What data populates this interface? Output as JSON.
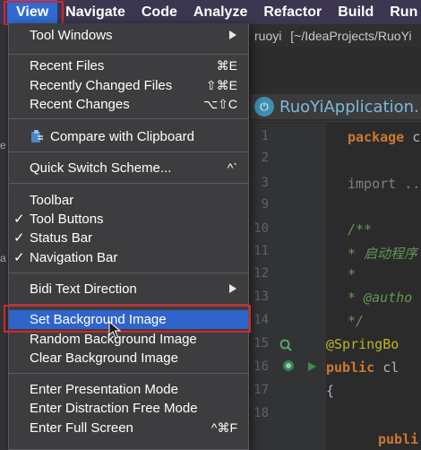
{
  "menubar": {
    "items": [
      "View",
      "Navigate",
      "Code",
      "Analyze",
      "Refactor",
      "Build",
      "Run"
    ],
    "active": "View"
  },
  "project": {
    "name": "ruoyi",
    "path": "[~/IdeaProjects/RuoYi"
  },
  "left_fragments": [
    "e",
    "a"
  ],
  "editor": {
    "tab_label": "RuoYiApplication.",
    "line_numbers": [
      "1",
      "2",
      "3",
      "9",
      "10",
      "11",
      "12",
      "13",
      "14",
      "15",
      "16",
      "17",
      "18"
    ],
    "code_lines": [
      {
        "kw": "package",
        "pl": " c"
      },
      {
        "dim": "import ..."
      },
      {
        "cm": "/**"
      },
      {
        "cm": " * 启动程序"
      },
      {
        "cm": " *"
      },
      {
        "cm": " * @autho"
      },
      {
        "cm": " */"
      },
      {
        "an": "@SpringBo"
      },
      {
        "kw": "public",
        "pl": " cl"
      },
      {
        "pl": "{"
      },
      {
        "kw": "publi"
      }
    ]
  },
  "view_menu": {
    "tool_windows": "Tool Windows",
    "recent_files": "Recent Files",
    "recent_files_sc": "⌘E",
    "recently_changed": "Recently Changed Files",
    "recently_changed_sc": "⇧⌘E",
    "recent_changes": "Recent Changes",
    "recent_changes_sc": "⌥⇧C",
    "compare_clipboard": "Compare with Clipboard",
    "quick_switch": "Quick Switch Scheme...",
    "quick_switch_sc": "^`",
    "toolbar": "Toolbar",
    "tool_buttons": "Tool Buttons",
    "status_bar": "Status Bar",
    "navigation_bar": "Navigation Bar",
    "check": "✓",
    "bidi": "Bidi Text Direction",
    "set_bg": "Set Background Image",
    "random_bg": "Random Background Image",
    "clear_bg": "Clear Background Image",
    "presentation": "Enter Presentation Mode",
    "distraction": "Enter Distraction Free Mode",
    "full_screen": "Enter Full Screen",
    "full_screen_sc": "^⌘F"
  },
  "colors": {
    "menubar_bg": "#3c3650",
    "menu_active": "#2f6bd0",
    "menu_bg": "#3d3d3f",
    "selection": "#2f65ca",
    "annotation_red": "#d6252d"
  }
}
